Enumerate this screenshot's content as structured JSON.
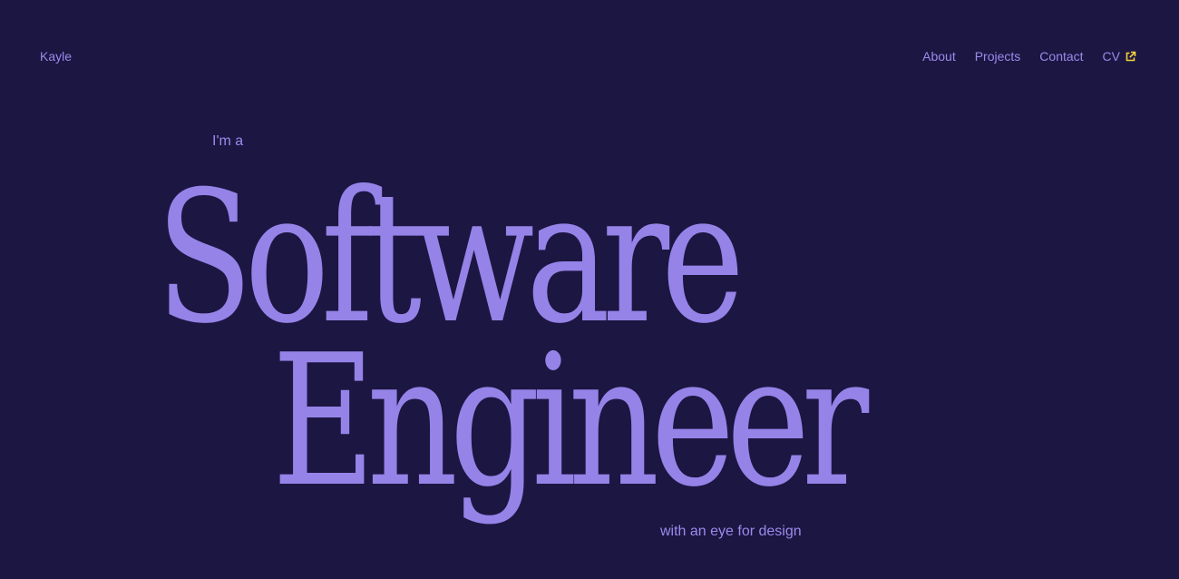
{
  "header": {
    "brand": "Kayle",
    "nav": {
      "about": "About",
      "projects": "Projects",
      "contact": "Contact",
      "cv": "CV"
    },
    "cv_icon": "external-link-icon"
  },
  "hero": {
    "intro": "I'm a",
    "line1": "Software",
    "line2": "Engineer",
    "tagline": "with an eye for design"
  },
  "colors": {
    "background": "#1c1642",
    "text": "#9b8aec",
    "accent_icon": "#f5d13a"
  }
}
